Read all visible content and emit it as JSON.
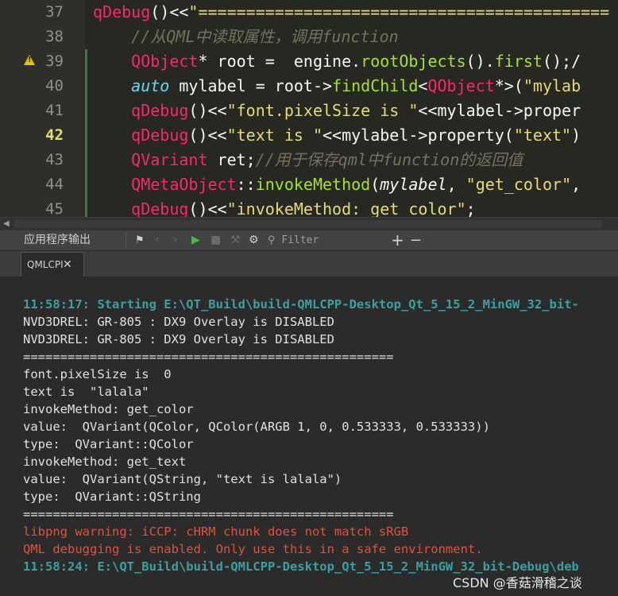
{
  "editor": {
    "active_line": "42",
    "lines": [
      {
        "num": "37",
        "parts": [
          [
            "k",
            "qDebug"
          ],
          [
            "t",
            "()<<"
          ],
          [
            "s",
            "\"==========================================="
          ]
        ]
      },
      {
        "num": "38",
        "parts": [
          [
            "t",
            "    "
          ],
          [
            "c",
            "//从QML中读取属性，调用function"
          ]
        ]
      },
      {
        "num": "39",
        "parts": [
          [
            "t",
            "    "
          ],
          [
            "k",
            "QObject"
          ],
          [
            "t",
            "* root =  engine."
          ],
          [
            "f",
            "rootObjects"
          ],
          [
            "t",
            "()."
          ],
          [
            "f",
            "first"
          ],
          [
            "t",
            "();/"
          ]
        ]
      },
      {
        "num": "40",
        "parts": [
          [
            "t",
            "    "
          ],
          [
            "i",
            "auto"
          ],
          [
            "t",
            " mylabel = root->"
          ],
          [
            "f",
            "findChild"
          ],
          [
            "t",
            "<"
          ],
          [
            "k",
            "QObject"
          ],
          [
            "t",
            "*>("
          ],
          [
            "s",
            "\"mylab"
          ]
        ]
      },
      {
        "num": "41",
        "parts": [
          [
            "t",
            "    "
          ],
          [
            "k",
            "qDebug"
          ],
          [
            "t",
            "()<<"
          ],
          [
            "s",
            "\"font.pixelSize is \""
          ],
          [
            "t",
            "<<mylabel->proper"
          ]
        ]
      },
      {
        "num": "42",
        "parts": [
          [
            "t",
            "    "
          ],
          [
            "k",
            "qDebug"
          ],
          [
            "t",
            "()<<"
          ],
          [
            "s",
            "\"text is \""
          ],
          [
            "t",
            "<<mylabel->property("
          ],
          [
            "s",
            "\"text\""
          ],
          [
            "t",
            ")"
          ]
        ]
      },
      {
        "num": "43",
        "parts": [
          [
            "t",
            "    "
          ],
          [
            "k",
            "QVariant"
          ],
          [
            "t",
            " ret;"
          ],
          [
            "c",
            "//用于保存qml中function的返回值"
          ]
        ]
      },
      {
        "num": "44",
        "parts": [
          [
            "t",
            "    "
          ],
          [
            "k",
            "QMetaObject"
          ],
          [
            "t",
            "::"
          ],
          [
            "f",
            "invokeMethod"
          ],
          [
            "t",
            "("
          ],
          [
            "p",
            "mylabel"
          ],
          [
            "t",
            ", "
          ],
          [
            "s",
            "\"get_color\""
          ],
          [
            "t",
            ","
          ]
        ]
      },
      {
        "num": "45",
        "parts": [
          [
            "t",
            "    "
          ],
          [
            "k",
            "qDebug"
          ],
          [
            "t",
            "()<<"
          ],
          [
            "s",
            "\"invokeMethod: get_color\""
          ],
          [
            "t",
            ";"
          ]
        ]
      }
    ]
  },
  "panel": {
    "title": "应用程序输出",
    "filter_placeholder": "Filter",
    "add_label": "+",
    "remove_label": "−",
    "tab_label": "QMLCPI",
    "tab_close": "✕"
  },
  "output": [
    {
      "type": "info",
      "text": "11:58:17: Starting E:\\QT_Build\\build-QMLCPP-Desktop_Qt_5_15_2_MinGW_32_bit-"
    },
    {
      "type": "normal",
      "text": "NVD3DREL: GR-805 : DX9 Overlay is DISABLED"
    },
    {
      "type": "normal",
      "text": "NVD3DREL: GR-805 : DX9 Overlay is DISABLED"
    },
    {
      "type": "normal",
      "text": "=================================================="
    },
    {
      "type": "normal",
      "text": "font.pixelSize is  0"
    },
    {
      "type": "normal",
      "text": "text is  \"lalala\""
    },
    {
      "type": "normal",
      "text": "invokeMethod: get_color"
    },
    {
      "type": "normal",
      "text": "value:  QVariant(QColor, QColor(ARGB 1, 0, 0.533333, 0.533333))"
    },
    {
      "type": "normal",
      "text": "type:  QVariant::QColor"
    },
    {
      "type": "normal",
      "text": "invokeMethod: get_text"
    },
    {
      "type": "normal",
      "text": "value:  QVariant(QString, \"text is lalala\")"
    },
    {
      "type": "normal",
      "text": "type:  QVariant::QString"
    },
    {
      "type": "normal",
      "text": "=================================================="
    },
    {
      "type": "err",
      "text": "libpng warning: iCCP: cHRM chunk does not match sRGB"
    },
    {
      "type": "err",
      "text": "QML debugging is enabled. Only use this in a safe environment."
    },
    {
      "type": "info",
      "text": "11:58:24: E:\\QT_Build\\build-QMLCPP-Desktop_Qt_5_15_2_MinGW_32_bit-Debug\\deb"
    }
  ],
  "watermark": "CSDN @香菇滑稽之谈"
}
